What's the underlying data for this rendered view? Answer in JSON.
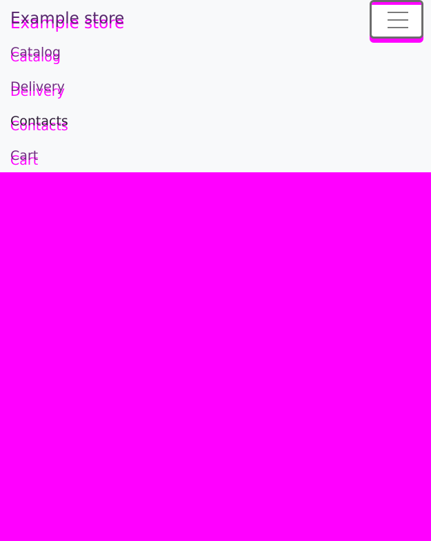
{
  "brand": {
    "name": "Example store"
  },
  "nav": {
    "items": [
      {
        "label": "Catalog"
      },
      {
        "label": "Delivery"
      },
      {
        "label": "Contacts"
      },
      {
        "label": "Cart"
      }
    ]
  },
  "toggler": {
    "icon": "hamburger-menu-icon"
  },
  "colors": {
    "navbar_background": "#f8f9fa",
    "page_background": "#ff00ff",
    "text_primary": "#56266c",
    "link_active": "#2d1c36",
    "link": "#6f2c80",
    "toggler_border": "#6c6c6c",
    "ghost_overlay": "#ff00ff"
  }
}
